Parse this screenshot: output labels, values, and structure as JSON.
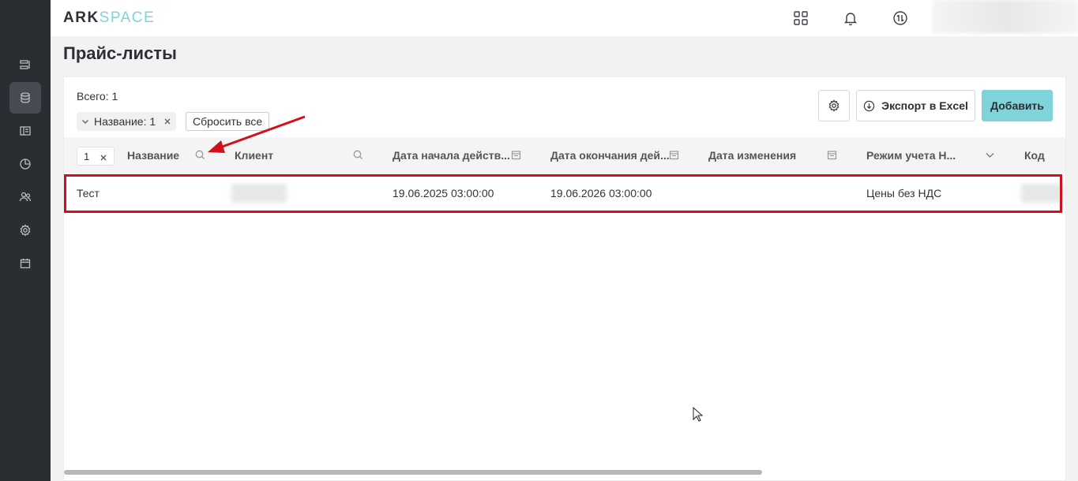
{
  "topbar": {
    "logo_ark": "ARK",
    "logo_space": "SPACE",
    "icons": [
      "apps-grid-icon",
      "bell-icon",
      "sync-arrows-icon"
    ]
  },
  "sidebar": {
    "items": [
      {
        "icon": "list-icon",
        "active": false
      },
      {
        "icon": "database-icon",
        "active": true
      },
      {
        "icon": "layout-icon",
        "active": false
      },
      {
        "icon": "pie-chart-icon",
        "active": false
      },
      {
        "icon": "users-icon",
        "active": false
      },
      {
        "icon": "gear-icon",
        "active": false
      },
      {
        "icon": "calendar-icon",
        "active": false
      }
    ]
  },
  "page": {
    "title": "Прайс-листы",
    "total": "Всего: 1",
    "filter_chip": "Название: 1",
    "reset_label": "Сбросить все",
    "export_label": "Экспорт в Excel",
    "add_label": "Добавить"
  },
  "table": {
    "count_value": "1",
    "columns": [
      {
        "label": "Название",
        "icon": "search-icon"
      },
      {
        "label": "Клиент",
        "icon": "search-icon"
      },
      {
        "label": "Дата начала действ...",
        "icon": "calendar-icon"
      },
      {
        "label": "Дата окончания дей...",
        "icon": "calendar-icon"
      },
      {
        "label": "Дата изменения",
        "icon": "calendar-icon"
      },
      {
        "label": "Режим учета Н...",
        "icon": "chevron-down-icon"
      },
      {
        "label": "Код",
        "icon": ""
      }
    ],
    "rows": [
      {
        "name": "Тест",
        "client": "",
        "start_date": "19.06.2025 03:00:00",
        "end_date": "19.06.2026 03:00:00",
        "modified": "",
        "vat_mode": "Цены без НДС",
        "code": ""
      }
    ]
  },
  "colors": {
    "accent": "#7fd3d9",
    "sidebar_bg": "#2a2d31",
    "highlight": "#d0101c"
  }
}
